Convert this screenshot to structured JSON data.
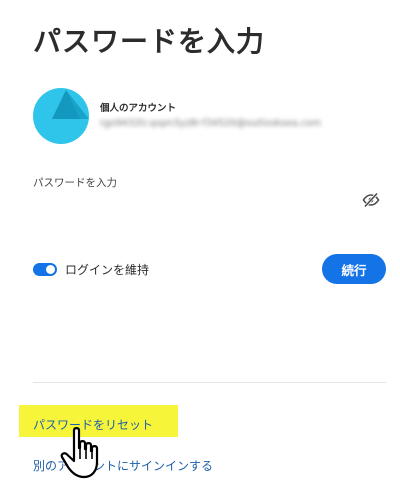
{
  "page": {
    "title": "パスワードを入力"
  },
  "account": {
    "type_label": "個人のアカウント",
    "email": "rgo9432tr.qxpn3yz8r-f34520@outlooksea.com",
    "avatar_color": "#2fc5ea"
  },
  "password": {
    "label": "パスワードを入力",
    "value": "",
    "visibility_icon": "eye-off-icon"
  },
  "remember": {
    "label": "ログインを維持",
    "checked": true
  },
  "actions": {
    "continue_label": "続行",
    "reset_password_label": "パスワードをリセット",
    "other_account_label": "別のアカウントにサインインする"
  },
  "colors": {
    "accent": "#1473e6",
    "link": "#1e5fa8",
    "highlight": "#f7f53a"
  }
}
